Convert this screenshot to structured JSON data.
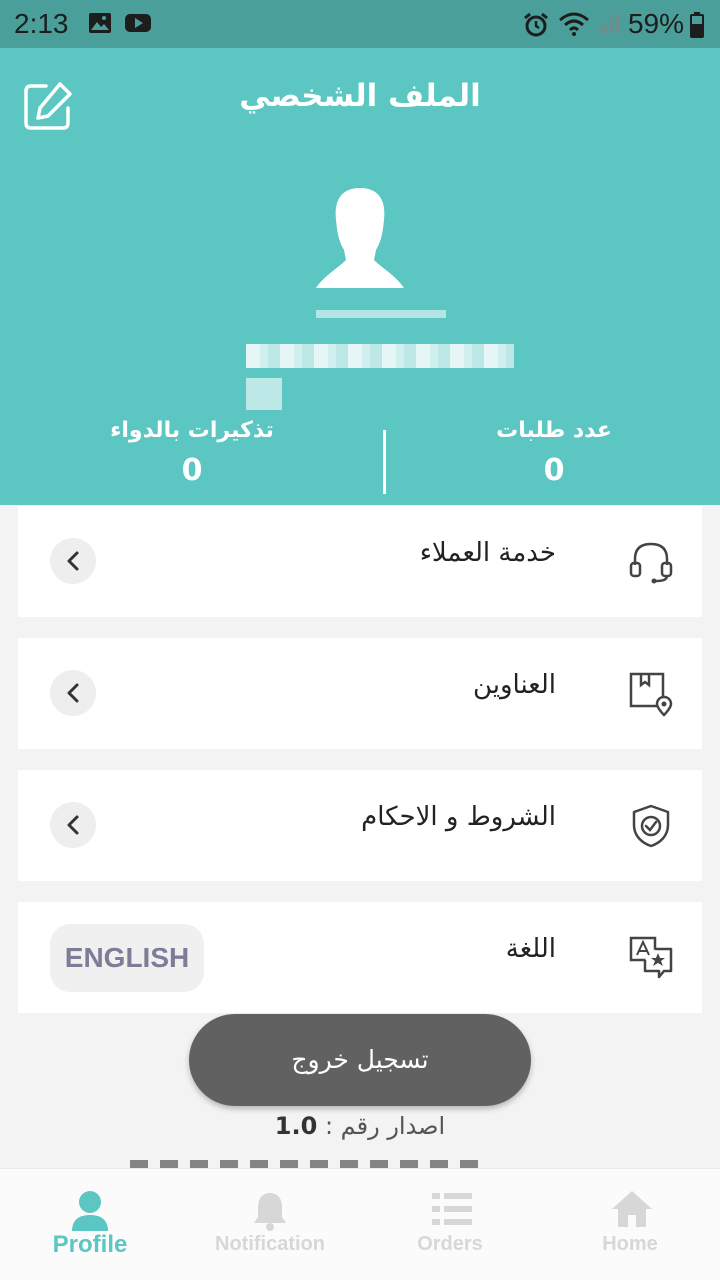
{
  "status_bar": {
    "time": "2:13",
    "battery": "59%"
  },
  "header": {
    "title": "الملف الشخصي",
    "stats": {
      "orders_label": "عدد طلبات",
      "orders_value": "0",
      "reminders_label": "تذكيرات بالدواء",
      "reminders_value": "0"
    }
  },
  "menu": {
    "customer_service": "خدمة العملاء",
    "addresses": "العناوين",
    "terms": "الشروط و الاحكام",
    "language_label": "اللغة",
    "language_button": "ENGLISH"
  },
  "logout_label": "تسجيل خروج",
  "version": {
    "label": "اصدار رقم :",
    "number": "1.0"
  },
  "bottom_nav": {
    "profile": "Profile",
    "notification": "Notification",
    "orders": "Orders",
    "home": "Home"
  },
  "colors": {
    "accent": "#5bc6c2",
    "status_bar": "#4a9f9b",
    "logout_bg": "#616161"
  }
}
